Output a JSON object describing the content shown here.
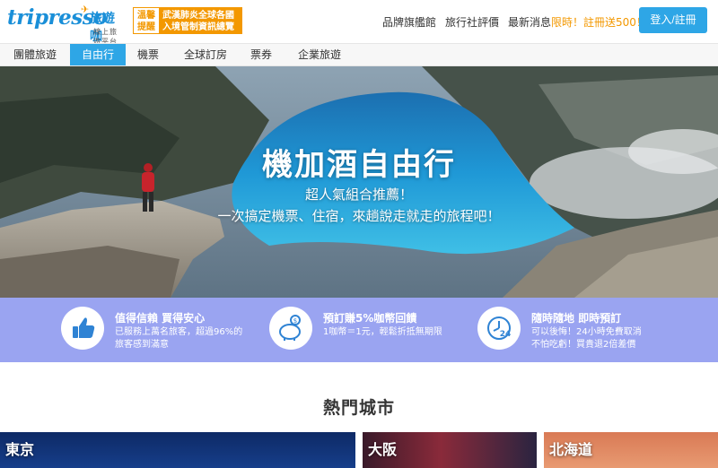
{
  "header": {
    "logo_text": "tripresso",
    "logo_cn": "旅遊咖",
    "logo_sub": "線上旅遊平台",
    "notice_tag": "溫馨提醒",
    "notice_text_line1": "武漢肺炎全球各國",
    "notice_text_line2": "入境管制資訊總覽",
    "nav": {
      "brand_store": "品牌旗艦館",
      "agency_review": "旅行社評價",
      "news_label": "最新消息",
      "news_promo": "限時！註冊送500！"
    },
    "login_label": "登入/註冊"
  },
  "tabs": [
    {
      "label": "團體旅遊",
      "active": false
    },
    {
      "label": "自由行",
      "active": true
    },
    {
      "label": "機票",
      "active": false
    },
    {
      "label": "全球訂房",
      "active": false
    },
    {
      "label": "票券",
      "active": false
    },
    {
      "label": "企業旅遊",
      "active": false
    }
  ],
  "hero": {
    "title": "機加酒自由行",
    "subtitle1": "超人氣組合推薦！",
    "subtitle2": "一次搞定機票、住宿，來趟說走就走的旅程吧！"
  },
  "features": [
    {
      "icon": "thumbs-up-icon",
      "title": "值得信賴 買得安心",
      "desc1": "已服務上萬名旅客，超過96%的",
      "desc2": "旅客感到滿意"
    },
    {
      "icon": "piggy-bank-icon",
      "title": "預訂賺5%咖幣回饋",
      "desc1": "1咖幣＝1元，輕鬆折抵無期限",
      "desc2": ""
    },
    {
      "icon": "clock-24-icon",
      "title": "隨時隨地 即時預訂",
      "desc1": "可以後悔！24小時免費取消",
      "desc2": "不怕吃虧！買貴退2倍差價"
    }
  ],
  "hot_cities": {
    "title": "熱門城市",
    "cities": [
      {
        "name": "東京"
      },
      {
        "name": "大阪"
      },
      {
        "name": "北海道"
      }
    ]
  },
  "colors": {
    "brand_blue": "#2ea6e6",
    "accent_orange": "#f39800",
    "feature_band": "#9aa4f1"
  }
}
